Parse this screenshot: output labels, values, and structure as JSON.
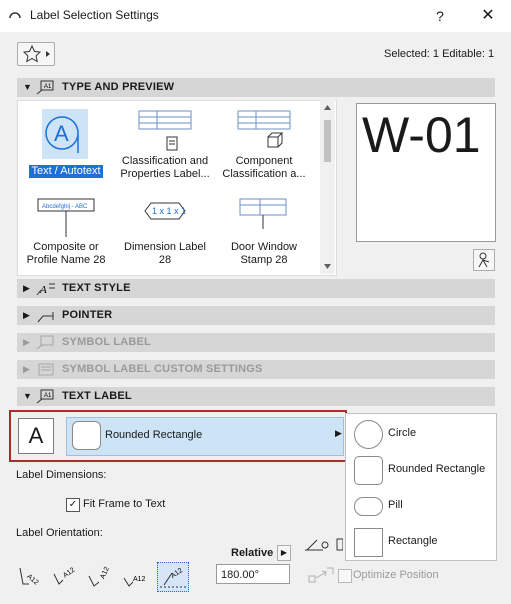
{
  "window": {
    "title": "Label Selection Settings",
    "help": "?",
    "close": "✕"
  },
  "header": {
    "selected_info": "Selected: 1 Editable: 1"
  },
  "sections": {
    "type_preview": "TYPE AND PREVIEW",
    "text_style": "TEXT STYLE",
    "pointer": "POINTER",
    "symbol_label": "SYMBOL LABEL",
    "symbol_custom": "SYMBOL LABEL CUSTOM SETTINGS",
    "text_label": "TEXT LABEL"
  },
  "gallery": {
    "items": [
      {
        "line1": "Text / Autotext",
        "line2": "",
        "selected": true
      },
      {
        "line1": "Classification and",
        "line2": "Properties Label..."
      },
      {
        "line1": "Component",
        "line2": "Classification a..."
      },
      {
        "line1": "Composite or",
        "line2": "Profile Name 28"
      },
      {
        "line1": "Dimension Label",
        "line2": "28"
      },
      {
        "line1": "Door Window",
        "line2": "Stamp 28"
      }
    ],
    "thumb_texts": {
      "composite": "Abcdefghij - ABC",
      "dimension": "1 x 1 x 1"
    }
  },
  "preview": {
    "text": "W-01"
  },
  "text_label": {
    "letter": "A",
    "shape_selected": "Rounded Rectangle",
    "shape_options": [
      "Circle",
      "Rounded Rectangle",
      "Pill",
      "Rectangle"
    ]
  },
  "dims": {
    "label": "Label Dimensions:",
    "fit_frame": "Fit Frame to Text",
    "fit_frame_checked": true
  },
  "orientation": {
    "label": "Label Orientation:",
    "relative": "Relative",
    "angle": "180.00°",
    "optimize_position": "Optimize Position",
    "btn_texts": [
      "A12",
      "A12",
      "A12",
      "A12",
      "A12"
    ]
  },
  "colors": {
    "accent": "#1e6fd9",
    "highlight_border": "#b02a2a",
    "selection_bg": "#cde3f6"
  }
}
